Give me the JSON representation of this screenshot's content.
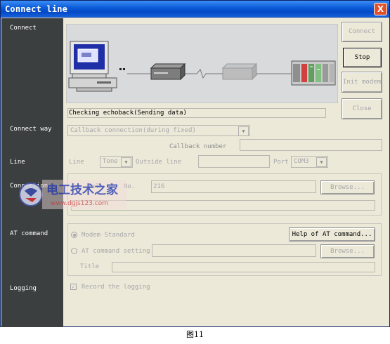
{
  "window": {
    "title": "Connect line",
    "close_glyph": "X"
  },
  "sidebar": {
    "connect": "Connect",
    "connect_way": "Connect way",
    "line": "Line",
    "connection": "Connection",
    "at_command": "AT command",
    "logging": "Logging"
  },
  "status_text": "Checking echoback(Sending data)",
  "buttons": {
    "connect": "Connect",
    "stop": "Stop",
    "init_modem": "Init modem",
    "close": "Close",
    "browse1": "Browse...",
    "help_at": "Help of AT command...",
    "browse2": "Browse..."
  },
  "connect_way": {
    "selected": "Callback connection(during fixed)",
    "callback_number_label": "Callback number",
    "callback_number_value": ""
  },
  "line": {
    "line_label": "Line",
    "line_select": "Tone",
    "outside_line_label": "Outside line",
    "outside_line_value": "",
    "port_label": "Port",
    "port_select": "COM3"
  },
  "connection": {
    "field_label_a": "Tel",
    "field_label_b": "No.",
    "field_value": "216"
  },
  "at_command": {
    "modem_standard": "Modem Standard",
    "at_command_setting": "AT command setting",
    "title_label": "Title"
  },
  "logging": {
    "record_label": "Record the logging",
    "checked": true
  },
  "watermark": {
    "brand": "电工技术之家",
    "url": "www.dgjs123.com"
  },
  "caption": "图11",
  "icons": {
    "window_close": "close-icon",
    "dropdown": "chevron-down-icon"
  }
}
